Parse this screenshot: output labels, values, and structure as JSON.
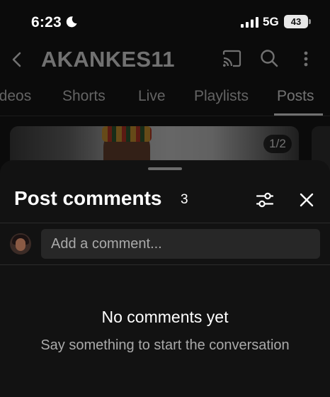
{
  "status_bar": {
    "time": "6:23",
    "network": "5G",
    "battery": "43"
  },
  "channel": {
    "title": "AKANKES11",
    "tabs": [
      {
        "label": "ideos"
      },
      {
        "label": "Shorts"
      },
      {
        "label": "Live"
      },
      {
        "label": "Playlists"
      },
      {
        "label": "Posts"
      }
    ],
    "active_tab": "Posts",
    "post": {
      "image_counter": "1/2"
    }
  },
  "sheet": {
    "title": "Post comments",
    "count": "3",
    "input_placeholder": "Add a comment...",
    "empty_title": "No comments yet",
    "empty_subtitle": "Say something to start the conversation"
  },
  "icons": {
    "status": [
      "moon-icon",
      "signal-icon",
      "battery-icon"
    ],
    "header": [
      "back-icon",
      "cast-icon",
      "search-icon",
      "more-icon"
    ],
    "sheet": [
      "filter-icon",
      "close-icon"
    ]
  },
  "colors": {
    "background": "#0b0b0b",
    "sheet": "#121212",
    "input": "#272727",
    "secondary_text": "#aaaaaa"
  }
}
